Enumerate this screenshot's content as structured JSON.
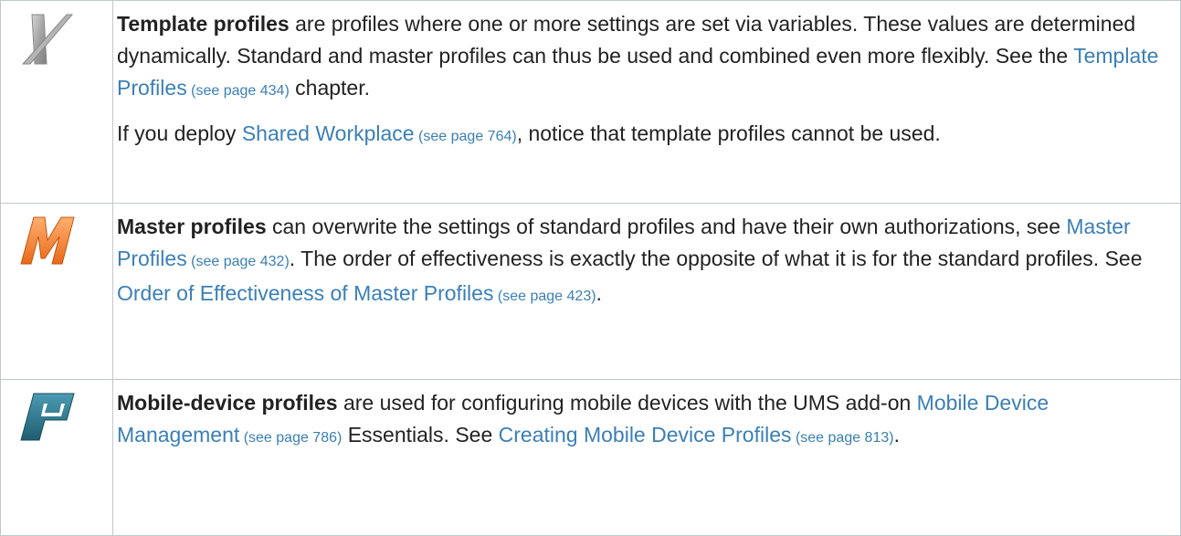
{
  "rows": [
    {
      "icon": "template-profile-icon",
      "color": "#9a9a9a",
      "term": "Template profiles",
      "p1_a": " are profiles where one or more settings are set via variables. These values are determined dynamically. Standard and master profiles can thus be used and combined even more flexibly. See the ",
      "p1_link": "Template Profiles",
      "p1_ref": " (see page 434)",
      "p1_b": " chapter.",
      "p2_a": "If you deploy ",
      "p2_link": "Shared Workplace",
      "p2_ref": " (see page 764)",
      "p2_b": ", notice that template profiles cannot be used."
    },
    {
      "icon": "master-profile-icon",
      "color": "#f07e26",
      "term": "Master profiles",
      "a": " can overwrite the settings of standard profiles and have their own authorizations, see ",
      "link1": "Master Profiles",
      "ref1": " (see page 432)",
      "b": ". The order of effectiveness is exactly the opposite of what it is for the standard profiles. See ",
      "link2": "Order of Effectiveness of Master Profiles",
      "ref2": " (see page 423)",
      "c": "."
    },
    {
      "icon": "mobile-device-profile-icon",
      "color": "#2f7a91",
      "term": "Mobile-device profiles",
      "a": " are used for configuring mobile devices with the UMS add-on ",
      "link1": "Mobile Device Management",
      "ref1": " (see page 786)",
      "b": " Essentials. See ",
      "link2": "Creating Mobile Device Profiles",
      "ref2": " (see page 813)",
      "c": "."
    }
  ]
}
